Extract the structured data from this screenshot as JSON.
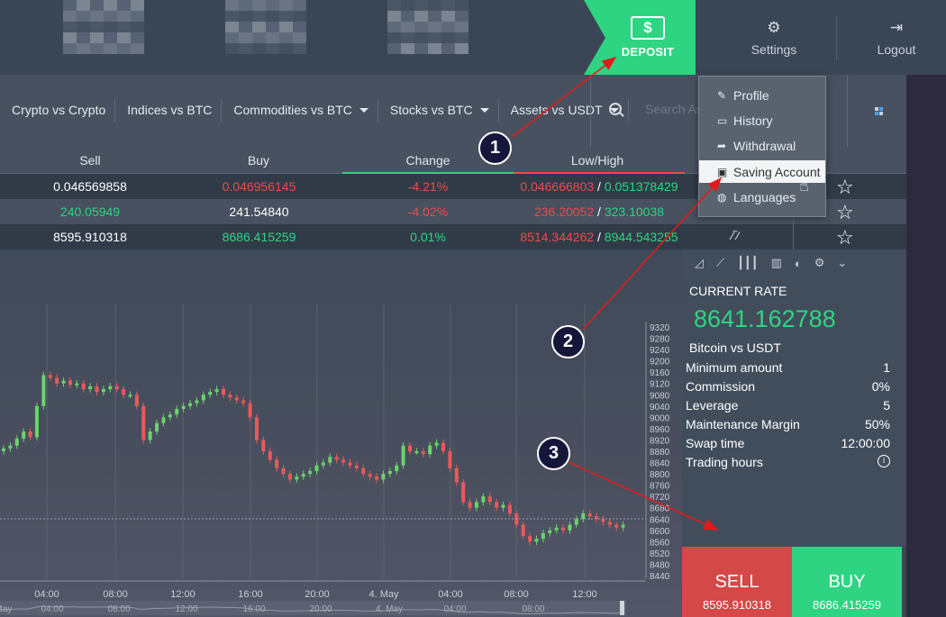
{
  "header": {
    "deposit_label": "DEPOSIT",
    "deposit_icon": "$",
    "settings_label": "Settings",
    "logout_label": "Logout"
  },
  "categories": [
    {
      "label": "Crypto vs Crypto",
      "dropdown": false
    },
    {
      "label": "Indices vs BTC",
      "dropdown": false
    },
    {
      "label": "Commodities vs BTC",
      "dropdown": true
    },
    {
      "label": "Stocks vs BTC",
      "dropdown": true
    },
    {
      "label": "Assets vs USDT",
      "dropdown": true
    }
  ],
  "search": {
    "placeholder": "Search Ass"
  },
  "table": {
    "headers": {
      "sell": "Sell",
      "buy": "Buy",
      "change": "Change",
      "lowhigh": "Low/High"
    },
    "rows": [
      {
        "sell": "0.046569858",
        "buy": "0.046956145",
        "change": "-4.21%",
        "low": "0.046666803",
        "sep": " / ",
        "high": "0.051378429"
      },
      {
        "sell": "240.05949",
        "buy": "241.54840",
        "change": "-4.02%",
        "low": "236.20052",
        "sep": " / ",
        "high": "323.10038"
      },
      {
        "sell": "8595.910318",
        "buy": "8686.415259",
        "change": "0.01%",
        "low": "8514.344262",
        "sep": " / ",
        "high": "8944.543255"
      }
    ]
  },
  "settings_menu": {
    "items": [
      {
        "label": "Profile",
        "icon": "edit-icon"
      },
      {
        "label": "History",
        "icon": "card-icon"
      },
      {
        "label": "Withdrawal",
        "icon": "share-icon"
      },
      {
        "label": "Saving Account",
        "icon": "briefcase-icon"
      },
      {
        "label": "Languages",
        "icon": "globe-icon"
      }
    ],
    "active_index": 3
  },
  "panel": {
    "current_rate_label": "CURRENT RATE",
    "current_rate": "8641.162788",
    "pair": "Bitcoin vs USDT",
    "info": [
      {
        "label": "Minimum amount",
        "value": "1"
      },
      {
        "label": "Commission",
        "value": "0%"
      },
      {
        "label": "Leverage",
        "value": "5"
      },
      {
        "label": "Maintenance Margin",
        "value": "50%"
      },
      {
        "label": "Swap time",
        "value": "12:00:00"
      },
      {
        "label": "Trading hours",
        "value": ""
      }
    ]
  },
  "trade": {
    "sell_label": "SELL",
    "sell_price": "8595.910318",
    "buy_label": "BUY",
    "buy_price": "8686.415259"
  },
  "annotations": [
    "1",
    "2",
    "3"
  ],
  "colors": {
    "accent_green": "#2fd482",
    "accent_red": "#ee4a4a",
    "annotation_red": "#e01b1b"
  },
  "chart_data": {
    "type": "candlestick",
    "y_ticks": [
      "9320",
      "9280",
      "9240",
      "9200",
      "9160",
      "9120",
      "9080",
      "9040",
      "9000",
      "8960",
      "8920",
      "8880",
      "8840",
      "8800",
      "8760",
      "8720",
      "8680",
      "8640",
      "8600",
      "8560",
      "8520",
      "8480",
      "8440"
    ],
    "ylim": [
      8440,
      9320
    ],
    "x_ticks": [
      "04:00",
      "08:00",
      "12:00",
      "16:00",
      "20:00",
      "4. May",
      "04:00",
      "08:00",
      "12:00"
    ],
    "navigator_ticks": [
      "May",
      "04:00",
      "08:00",
      "12:00",
      "16:00",
      "20:00",
      "4. May",
      "04:00",
      "08:00"
    ],
    "current_price": 8641,
    "close_series": [
      8890,
      8900,
      8925,
      8950,
      8930,
      9040,
      9150,
      9140,
      9120,
      9130,
      9115,
      9120,
      9100,
      9110,
      9090,
      9100,
      9110,
      9100,
      9080,
      9080,
      9040,
      8920,
      8950,
      8980,
      9000,
      9010,
      9030,
      9040,
      9050,
      9060,
      9080,
      9090,
      9100,
      9080,
      9070,
      9060,
      9050,
      9000,
      8920,
      8880,
      8850,
      8820,
      8800,
      8780,
      8790,
      8800,
      8810,
      8830,
      8840,
      8860,
      8850,
      8840,
      8830,
      8820,
      8800,
      8790,
      8780,
      8800,
      8810,
      8830,
      8900,
      8880,
      8880,
      8870,
      8900,
      8910,
      8880,
      8820,
      8770,
      8700,
      8680,
      8700,
      8720,
      8700,
      8680,
      8690,
      8660,
      8620,
      8580,
      8560,
      8570,
      8590,
      8600,
      8610,
      8600,
      8620,
      8640,
      8660,
      8650,
      8640,
      8630,
      8620,
      8610,
      8620
    ]
  }
}
